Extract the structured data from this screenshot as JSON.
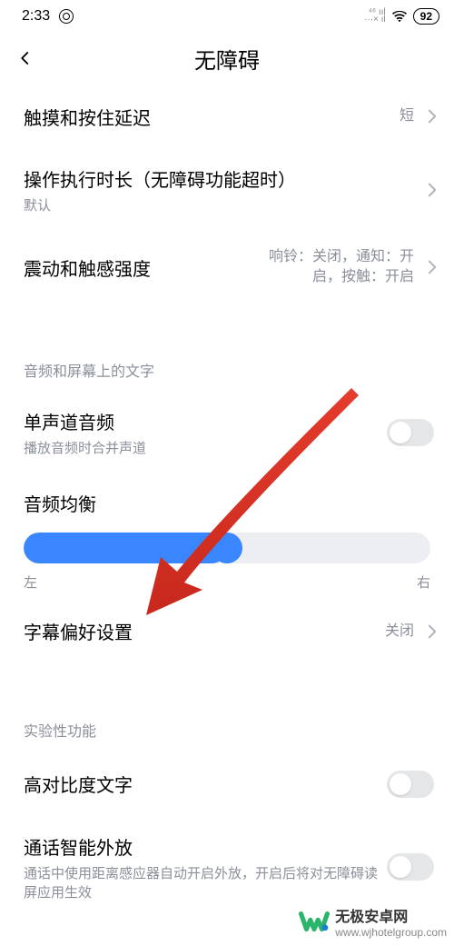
{
  "status": {
    "time": "2:33",
    "battery": "92"
  },
  "header": {
    "title": "无障碍"
  },
  "group1": {
    "touch_hold": {
      "title": "触摸和按住延迟",
      "value": "短"
    },
    "action_timeout": {
      "title": "操作执行时长（无障碍功能超时）",
      "sub": "默认"
    },
    "vibration": {
      "title": "震动和触感强度",
      "value": "响铃：关闭，通知：开启，按触：开启"
    }
  },
  "group2": {
    "header": "音频和屏幕上的文字",
    "mono": {
      "title": "单声道音频",
      "sub": "播放音频时合并声道"
    },
    "balance": {
      "title": "音频均衡",
      "left": "左",
      "right": "右"
    },
    "caption": {
      "title": "字幕偏好设置",
      "value": "关闭"
    }
  },
  "group3": {
    "header": "实验性功能",
    "high_contrast": {
      "title": "高对比度文字"
    },
    "smart_speaker": {
      "title": "通话智能外放",
      "sub": "通话中使用距离感应器自动开启外放，开启后将对无障碍读屏应用生效"
    }
  },
  "watermark": {
    "name": "无极安卓网",
    "url": "www.wjhotelgroup.com"
  }
}
